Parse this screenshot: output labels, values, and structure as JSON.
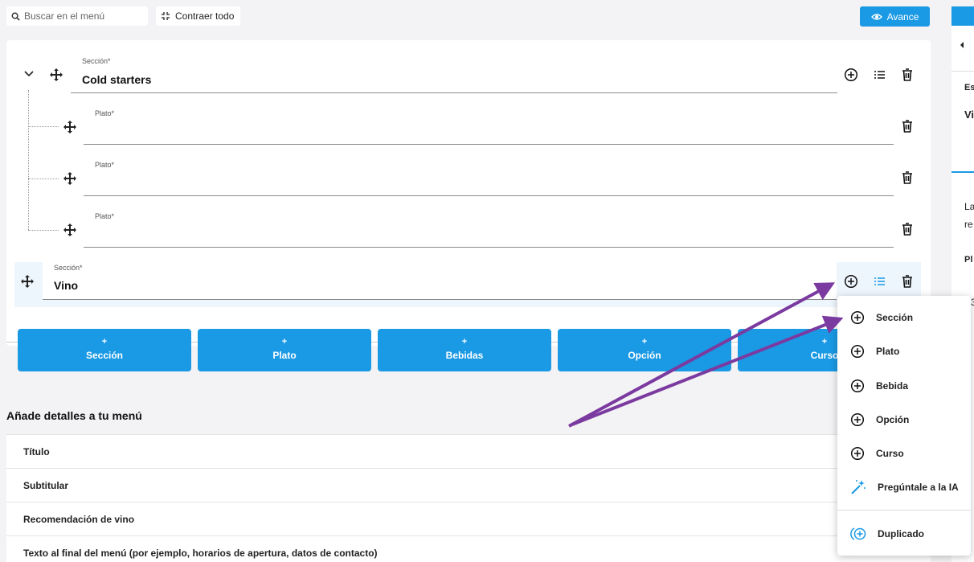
{
  "toolbar": {
    "search_placeholder": "Buscar en el menú",
    "collapse_label": "Contraer todo",
    "preview_label": "Avance"
  },
  "side_panel": {
    "texts": [
      "Es",
      "Vi",
      "La",
      "re",
      "Pl",
      "3"
    ]
  },
  "menu": {
    "section_label": "Sección*",
    "dish_label": "Plato*",
    "section1_name": "Cold starters",
    "section2_name": "Vino"
  },
  "add_buttons": {
    "plus": "+",
    "items": [
      "Sección",
      "Plato",
      "Bebidas",
      "Opción",
      "Curso"
    ]
  },
  "details": {
    "title": "Añade detalles a tu menú",
    "rows": [
      "Título",
      "Subtitular",
      "Recomendación de vino",
      "Texto al final del menú (por ejemplo, horarios de apertura, datos de contacto)"
    ]
  },
  "dropdown": {
    "items": [
      "Sección",
      "Plato",
      "Bebida",
      "Opción",
      "Curso",
      "Pregúntale a la IA",
      "Duplicado"
    ]
  },
  "colors": {
    "accent": "#1a99e4",
    "arrow": "#7b3aa0"
  }
}
